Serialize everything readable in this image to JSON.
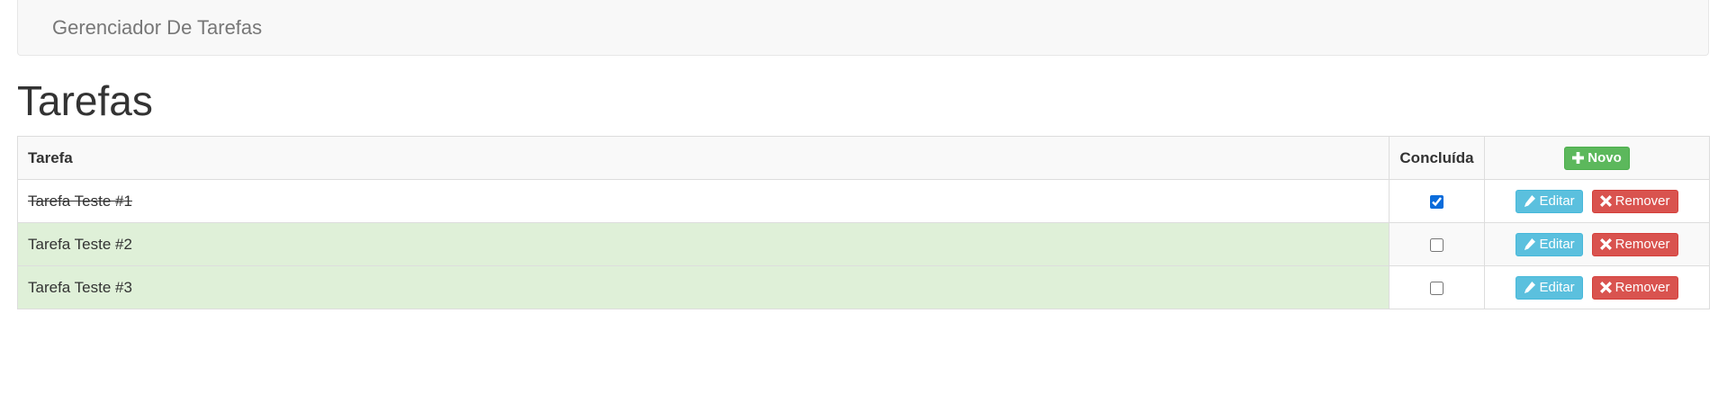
{
  "navbar": {
    "brand": "Gerenciador De Tarefas"
  },
  "page": {
    "title": "Tarefas"
  },
  "table": {
    "headers": {
      "task": "Tarefa",
      "done": "Concluída"
    },
    "new_button_label": "Novo",
    "edit_label": "Editar",
    "remove_label": "Remover",
    "rows": [
      {
        "name": "Tarefa Teste #1",
        "done": true
      },
      {
        "name": "Tarefa Teste #2",
        "done": false
      },
      {
        "name": "Tarefa Teste #3",
        "done": false
      }
    ]
  },
  "colors": {
    "success": "#5cb85c",
    "info": "#5bc0de",
    "danger": "#d9534f",
    "row_highlight": "#dff0d8"
  },
  "icons": {
    "new": "plus-icon",
    "edit": "pencil-icon",
    "remove": "x-icon"
  }
}
